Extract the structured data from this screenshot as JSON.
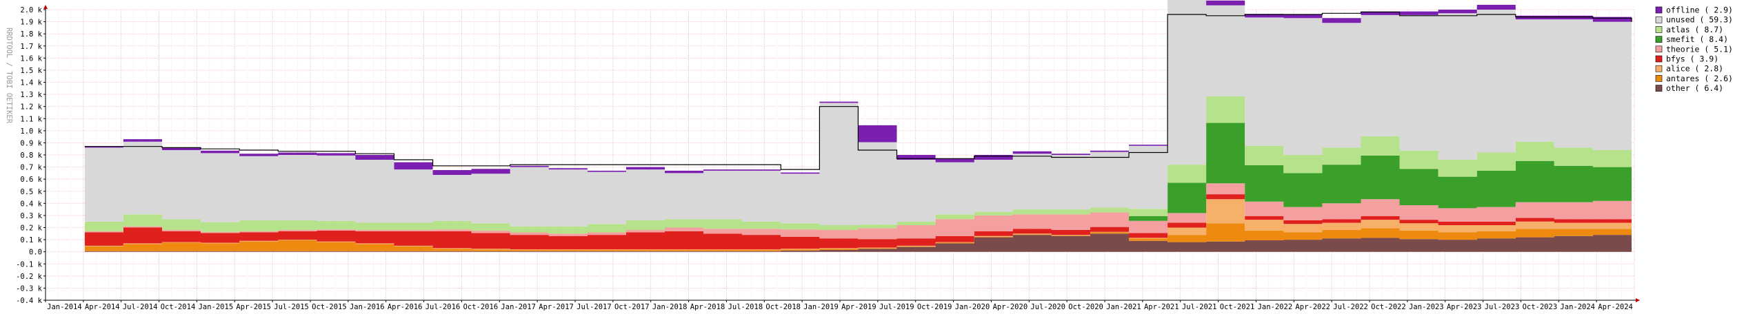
{
  "chart_data": {
    "type": "area",
    "title": "",
    "ylabel": "RRDTOOL / TOBI OETIKER",
    "xlabel": "",
    "ylim": [
      -400,
      2000
    ],
    "y_ticks": [
      {
        "v": 2000,
        "label": "2.0 k"
      },
      {
        "v": 1900,
        "label": "1.9 k"
      },
      {
        "v": 1800,
        "label": "1.8 k"
      },
      {
        "v": 1700,
        "label": "1.7 k"
      },
      {
        "v": 1600,
        "label": "1.6 k"
      },
      {
        "v": 1500,
        "label": "1.5 k"
      },
      {
        "v": 1400,
        "label": "1.4 k"
      },
      {
        "v": 1300,
        "label": "1.3 k"
      },
      {
        "v": 1200,
        "label": "1.2 k"
      },
      {
        "v": 1100,
        "label": "1.1 k"
      },
      {
        "v": 1000,
        "label": "1.0 k"
      },
      {
        "v": 900,
        "label": "0.9 k"
      },
      {
        "v": 800,
        "label": "0.8 k"
      },
      {
        "v": 700,
        "label": "0.7 k"
      },
      {
        "v": 600,
        "label": "0.6 k"
      },
      {
        "v": 500,
        "label": "0.5 k"
      },
      {
        "v": 400,
        "label": "0.4 k"
      },
      {
        "v": 300,
        "label": "0.3 k"
      },
      {
        "v": 200,
        "label": "0.2 k"
      },
      {
        "v": 100,
        "label": "0.1 k"
      },
      {
        "v": 0,
        "label": "0.0"
      },
      {
        "v": -100,
        "label": "-0.1 k"
      },
      {
        "v": -200,
        "label": "-0.2 k"
      },
      {
        "v": -300,
        "label": "-0.3 k"
      },
      {
        "v": -400,
        "label": "-0.4 k"
      }
    ],
    "x_ticks": [
      "Jan-2014",
      "Apr-2014",
      "Jul-2014",
      "Oct-2014",
      "Jan-2015",
      "Apr-2015",
      "Jul-2015",
      "Oct-2015",
      "Jan-2016",
      "Apr-2016",
      "Jul-2016",
      "Oct-2016",
      "Jan-2017",
      "Apr-2017",
      "Jul-2017",
      "Oct-2017",
      "Jan-2018",
      "Apr-2018",
      "Jul-2018",
      "Oct-2018",
      "Jan-2019",
      "Apr-2019",
      "Jul-2019",
      "Oct-2019",
      "Jan-2020",
      "Apr-2020",
      "Jul-2020",
      "Oct-2020",
      "Jan-2021",
      "Apr-2021",
      "Jul-2021",
      "Oct-2021",
      "Jan-2022",
      "Apr-2022",
      "Jul-2022",
      "Oct-2022",
      "Jan-2023",
      "Apr-2023",
      "Jul-2023",
      "Oct-2023",
      "Jan-2024",
      "Apr-2024"
    ],
    "x_start": "2014-04-01",
    "legend_position": "right",
    "grid": true,
    "x": [
      "2014-04",
      "2014-07",
      "2014-10",
      "2015-01",
      "2015-04",
      "2015-07",
      "2015-10",
      "2016-01",
      "2016-04",
      "2016-07",
      "2016-10",
      "2017-01",
      "2017-04",
      "2017-07",
      "2017-10",
      "2018-01",
      "2018-04",
      "2018-07",
      "2018-10",
      "2019-01",
      "2019-04",
      "2019-07",
      "2019-10",
      "2020-01",
      "2020-04",
      "2020-07",
      "2020-10",
      "2021-01",
      "2021-04",
      "2021-07",
      "2021-10",
      "2022-01",
      "2022-04",
      "2022-07",
      "2022-10",
      "2023-01",
      "2023-04",
      "2023-07",
      "2023-10",
      "2024-01",
      "2024-04"
    ],
    "series": [
      {
        "name": "other",
        "legend": "other ( 6.4)",
        "color": "#7b4a4a",
        "values": [
          5,
          5,
          5,
          5,
          5,
          5,
          5,
          5,
          5,
          5,
          5,
          5,
          5,
          5,
          5,
          5,
          5,
          5,
          10,
          15,
          25,
          40,
          70,
          120,
          140,
          130,
          150,
          90,
          80,
          85,
          95,
          100,
          110,
          115,
          105,
          100,
          110,
          120,
          130,
          140,
          150
        ]
      },
      {
        "name": "antares",
        "legend": "antares ( 2.6)",
        "color": "#ee8a10",
        "values": [
          40,
          60,
          70,
          65,
          80,
          90,
          75,
          60,
          40,
          20,
          15,
          10,
          10,
          10,
          10,
          10,
          10,
          10,
          10,
          10,
          5,
          5,
          5,
          5,
          5,
          5,
          10,
          20,
          60,
          150,
          80,
          60,
          70,
          80,
          70,
          60,
          60,
          70,
          60,
          50,
          40
        ]
      },
      {
        "name": "alice",
        "legend": "alice ( 2.8)",
        "color": "#f7b06a",
        "values": [
          5,
          5,
          5,
          5,
          5,
          5,
          5,
          5,
          5,
          5,
          5,
          5,
          5,
          5,
          5,
          5,
          5,
          5,
          5,
          5,
          5,
          5,
          5,
          5,
          5,
          5,
          5,
          5,
          60,
          200,
          90,
          70,
          60,
          70,
          60,
          60,
          50,
          60,
          50,
          50,
          40
        ]
      },
      {
        "name": "bfys",
        "legend": "bfys ( 3.9)",
        "color": "#e0201c",
        "values": [
          110,
          130,
          90,
          80,
          70,
          70,
          90,
          100,
          120,
          140,
          130,
          120,
          110,
          120,
          140,
          150,
          130,
          120,
          100,
          80,
          70,
          60,
          50,
          40,
          40,
          40,
          40,
          40,
          40,
          40,
          30,
          30,
          30,
          30,
          30,
          30,
          30,
          30,
          30,
          30,
          30
        ]
      },
      {
        "name": "theorie",
        "legend": "theorie ( 5.1)",
        "color": "#f4a0a0",
        "values": [
          10,
          10,
          10,
          10,
          10,
          10,
          10,
          10,
          10,
          15,
          20,
          20,
          20,
          20,
          20,
          30,
          40,
          50,
          60,
          70,
          90,
          110,
          140,
          130,
          120,
          130,
          120,
          100,
          80,
          90,
          120,
          110,
          130,
          140,
          120,
          110,
          120,
          130,
          140,
          150,
          160
        ]
      },
      {
        "name": "smefit",
        "legend": "smefit ( 8.4)",
        "color": "#3aa02a",
        "values": [
          0,
          0,
          0,
          0,
          0,
          0,
          0,
          0,
          0,
          0,
          0,
          0,
          0,
          0,
          0,
          0,
          0,
          0,
          0,
          0,
          0,
          0,
          0,
          0,
          0,
          0,
          0,
          40,
          250,
          500,
          300,
          280,
          320,
          360,
          300,
          260,
          300,
          340,
          300,
          280,
          260
        ]
      },
      {
        "name": "atlas",
        "legend": "atlas ( 8.7)",
        "color": "#b6e28c",
        "values": [
          80,
          100,
          90,
          80,
          90,
          80,
          70,
          60,
          60,
          70,
          60,
          50,
          60,
          70,
          80,
          70,
          80,
          60,
          50,
          40,
          30,
          30,
          40,
          30,
          40,
          40,
          40,
          60,
          150,
          220,
          160,
          150,
          140,
          160,
          150,
          140,
          150,
          160,
          150,
          140,
          130
        ]
      },
      {
        "name": "unused",
        "legend": "unused ( 59.3)",
        "color": "#d8d8d8",
        "values": [
          610,
          600,
          570,
          570,
          530,
          540,
          540,
          520,
          440,
          380,
          410,
          490,
          470,
          430,
          420,
          380,
          400,
          420,
          410,
          1010,
          680,
          510,
          430,
          430,
          460,
          450,
          460,
          520,
          1530,
          750,
          1060,
          1130,
          1030,
          1000,
          1120,
          1210,
          1180,
          1010,
          1060,
          1060,
          1100
        ]
      },
      {
        "name": "offline",
        "legend": "offline ( 2.9)",
        "color": "#7a1fb0",
        "values": [
          10,
          20,
          20,
          20,
          20,
          20,
          20,
          40,
          60,
          40,
          40,
          10,
          10,
          10,
          20,
          20,
          10,
          10,
          10,
          10,
          140,
          40,
          30,
          40,
          20,
          10,
          10,
          10,
          30,
          40,
          30,
          30,
          40,
          30,
          30,
          30,
          40,
          30,
          30,
          40,
          80
        ]
      }
    ],
    "total": [
      870,
      870,
      860,
      850,
      840,
      830,
      830,
      810,
      760,
      710,
      710,
      720,
      720,
      720,
      720,
      720,
      720,
      720,
      680,
      1200,
      840,
      770,
      770,
      790,
      790,
      780,
      780,
      820,
      1960,
      1950,
      1960,
      1960,
      1970,
      1980,
      1950,
      1950,
      1960,
      1940,
      1940,
      1930,
      1900
    ]
  }
}
